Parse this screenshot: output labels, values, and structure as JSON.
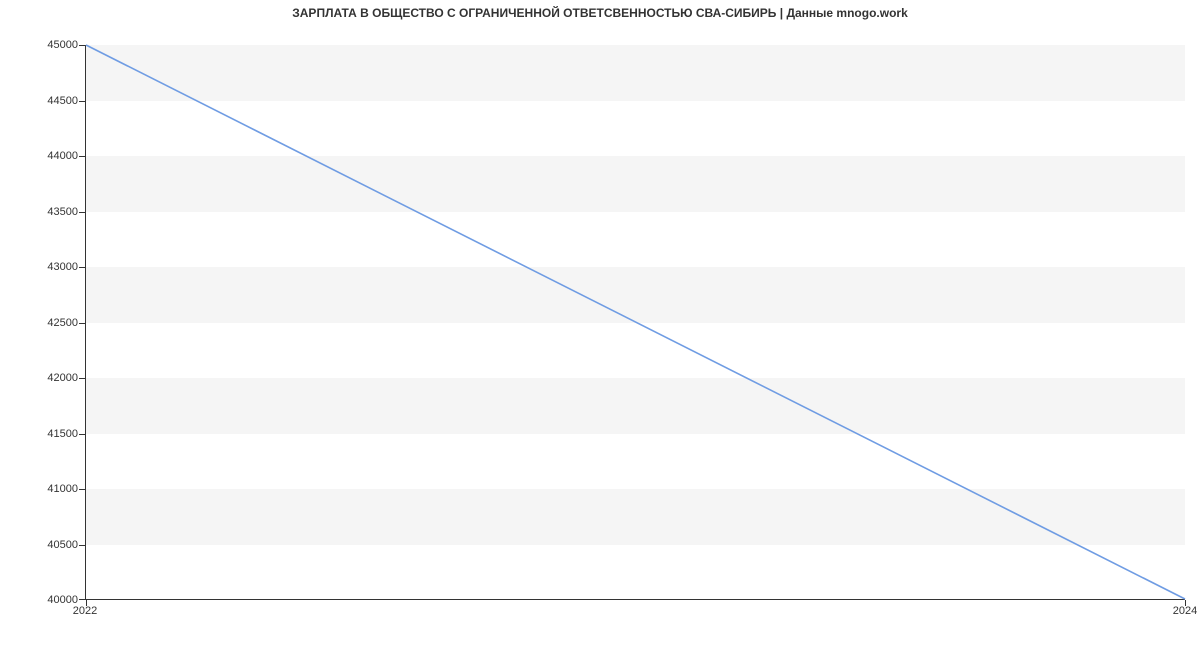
{
  "chart_data": {
    "type": "line",
    "title": "ЗАРПЛАТА В ОБЩЕСТВО С ОГРАНИЧЕННОЙ ОТВЕТСВЕННОСТЬЮ СВА-СИБИРЬ | Данные mnogo.work",
    "xlabel": "",
    "ylabel": "",
    "x": [
      2022,
      2024
    ],
    "values": [
      45000,
      40000
    ],
    "xlim": [
      2022,
      2024
    ],
    "ylim": [
      40000,
      45000
    ],
    "x_ticks": [
      2022,
      2024
    ],
    "y_ticks": [
      40000,
      40500,
      41000,
      41500,
      42000,
      42500,
      43000,
      43500,
      44000,
      44500,
      45000
    ],
    "line_color": "#6f9ce3",
    "band_color": "#f5f5f5"
  }
}
